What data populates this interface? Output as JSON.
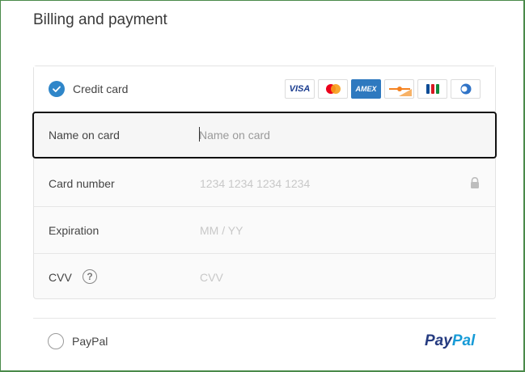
{
  "header": {
    "title": "Billing and payment"
  },
  "credit_card": {
    "label": "Credit card",
    "selected": true,
    "brands": [
      "visa",
      "mastercard",
      "amex",
      "discover",
      "jcb",
      "diners"
    ],
    "brand_text": {
      "visa": "VISA",
      "amex": "AMEX"
    }
  },
  "fields": {
    "name": {
      "label": "Name on card",
      "placeholder": "Name on card",
      "value": ""
    },
    "number": {
      "label": "Card number",
      "placeholder": "1234 1234 1234 1234",
      "value": ""
    },
    "expiration": {
      "label": "Expiration",
      "placeholder": "MM / YY",
      "value": ""
    },
    "cvv": {
      "label": "CVV",
      "placeholder": "CVV",
      "value": "",
      "help": "?"
    }
  },
  "paypal": {
    "label": "PayPal",
    "selected": false,
    "logo_a": "Pay",
    "logo_b": "Pal"
  },
  "colors": {
    "accent": "#2f86c9",
    "paypal_dark": "#253b80",
    "paypal_light": "#179bd7"
  }
}
